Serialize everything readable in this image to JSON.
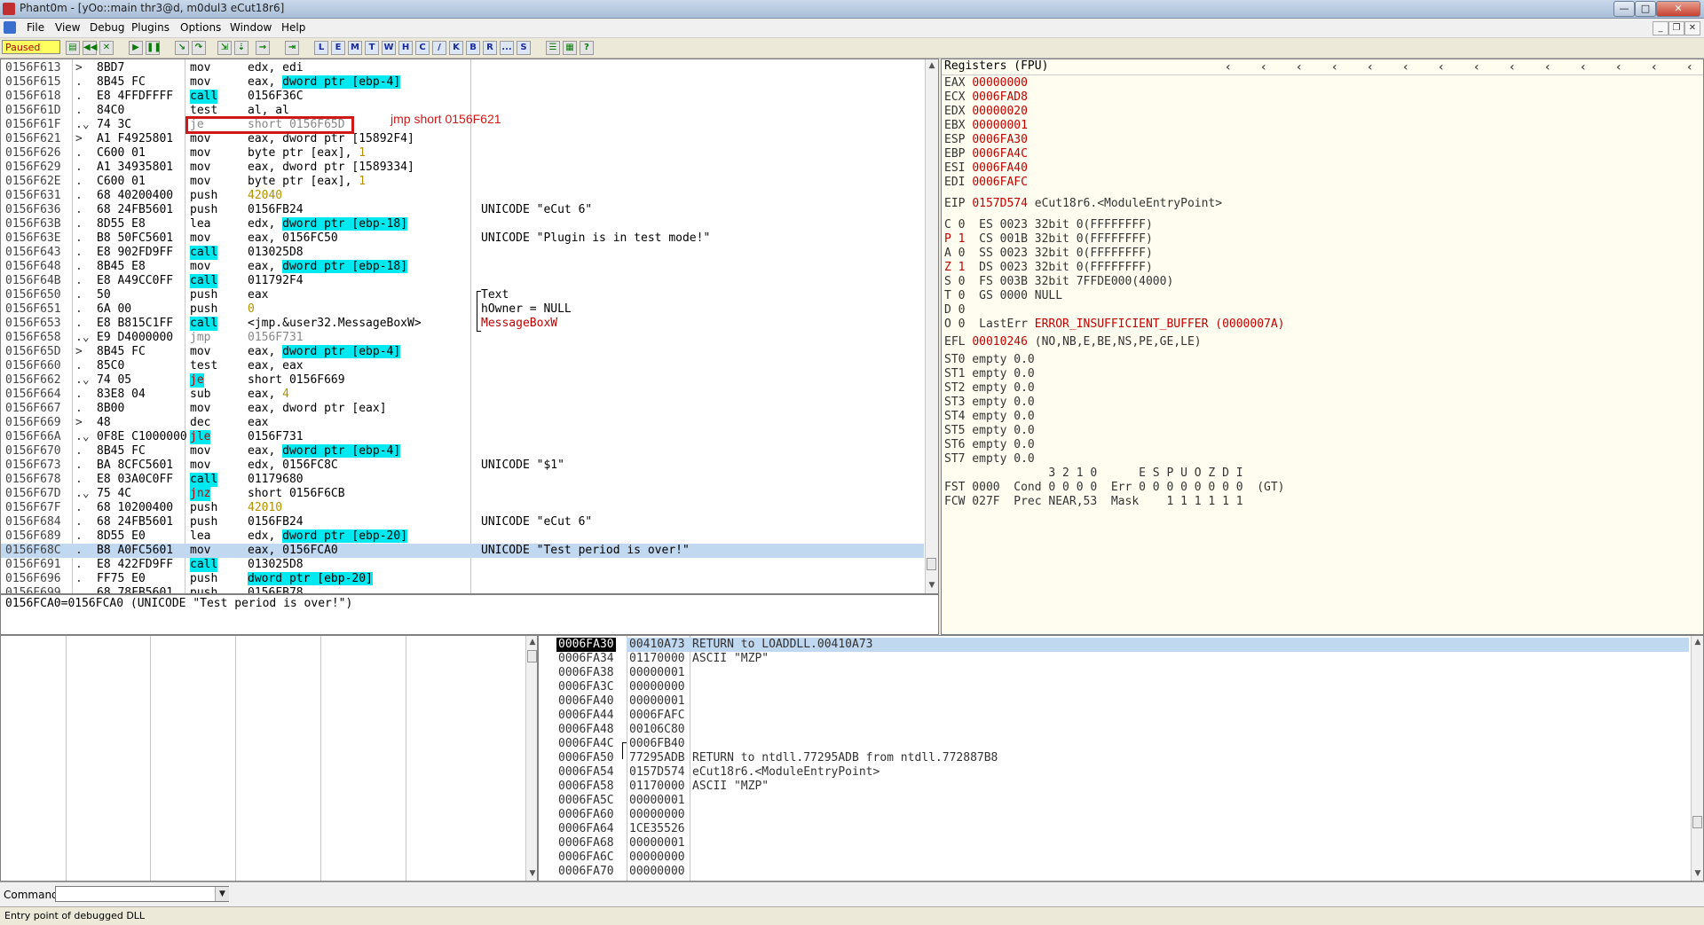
{
  "window": {
    "title": "Phant0m - [yOo::main thr3@d, m0dul3 eCut18r6]",
    "min_label": "—",
    "max_label": "□",
    "close_label": "✕"
  },
  "menu": [
    "File",
    "View",
    "Debug",
    "Plugins",
    "Options",
    "Window",
    "Help"
  ],
  "toolbar": {
    "status": "Paused",
    "letter_buttons": [
      "L",
      "E",
      "M",
      "T",
      "W",
      "H",
      "C",
      "/",
      "K",
      "B",
      "R",
      "...",
      "S"
    ]
  },
  "cpu": {
    "rows": [
      {
        "addr": "0156F613",
        "mark": ">",
        "hex": "8BD7",
        "mn": "mov",
        "op": "edx, edi",
        "cm": ""
      },
      {
        "addr": "0156F615",
        "mark": ".",
        "hex": "8B45 FC",
        "mn": "mov",
        "op": "eax, ",
        "mem": "dword ptr [ebp-4]",
        "cm": ""
      },
      {
        "addr": "0156F618",
        "mark": ".",
        "hex": "E8 4FFDFFFF",
        "mn": "call",
        "op": "0156F36C",
        "cm": "",
        "mnhl": true
      },
      {
        "addr": "0156F61D",
        "mark": ".",
        "hex": "84C0",
        "mn": "test",
        "op": "al, al",
        "cm": ""
      },
      {
        "addr": "0156F61F",
        "mark": ".⌄",
        "hex": "74 3C",
        "mn": "je",
        "op": "short 0156F65D",
        "cm": "",
        "grey": true
      },
      {
        "addr": "0156F621",
        "mark": ">",
        "hex": "A1 F4925801",
        "mn": "mov",
        "op": "eax, dword ptr [15892F4]",
        "cm": ""
      },
      {
        "addr": "0156F626",
        "mark": ".",
        "hex": "C600 01",
        "mn": "mov",
        "op": "byte ptr [eax], ",
        "num": "1",
        "cm": ""
      },
      {
        "addr": "0156F629",
        "mark": ".",
        "hex": "A1 34935801",
        "mn": "mov",
        "op": "eax, dword ptr [1589334]",
        "cm": ""
      },
      {
        "addr": "0156F62E",
        "mark": ".",
        "hex": "C600 01",
        "mn": "mov",
        "op": "byte ptr [eax], ",
        "num": "1",
        "cm": ""
      },
      {
        "addr": "0156F631",
        "mark": ".",
        "hex": "68 40200400",
        "mn": "push",
        "op": "",
        "num": "42040",
        "cm": ""
      },
      {
        "addr": "0156F636",
        "mark": ".",
        "hex": "68 24FB5601",
        "mn": "push",
        "op": "0156FB24",
        "cm": "UNICODE \"eCut 6\""
      },
      {
        "addr": "0156F63B",
        "mark": ".",
        "hex": "8D55 E8",
        "mn": "lea",
        "op": "edx, ",
        "mem": "dword ptr [ebp-18]",
        "cm": ""
      },
      {
        "addr": "0156F63E",
        "mark": ".",
        "hex": "B8 50FC5601",
        "mn": "mov",
        "op": "eax, 0156FC50",
        "cm": "UNICODE \"Plugin is in test mode!\""
      },
      {
        "addr": "0156F643",
        "mark": ".",
        "hex": "E8 902FD9FF",
        "mn": "call",
        "op": "013025D8",
        "cm": "",
        "mnhl": true
      },
      {
        "addr": "0156F648",
        "mark": ".",
        "hex": "8B45 E8",
        "mn": "mov",
        "op": "eax, ",
        "mem": "dword ptr [ebp-18]",
        "cm": ""
      },
      {
        "addr": "0156F64B",
        "mark": ".",
        "hex": "E8 A49CC0FF",
        "mn": "call",
        "op": "011792F4",
        "cm": "",
        "mnhl": true
      },
      {
        "addr": "0156F650",
        "mark": ".",
        "hex": "50",
        "mn": "push",
        "op": "eax",
        "cm": "Text"
      },
      {
        "addr": "0156F651",
        "mark": ".",
        "hex": "6A 00",
        "mn": "push",
        "op": "",
        "num": "0",
        "cm": "hOwner = NULL"
      },
      {
        "addr": "0156F653",
        "mark": ".",
        "hex": "E8 B815C1FF",
        "mn": "call",
        "op": "<jmp.&user32.MessageBoxW>",
        "cm": "MessageBoxW",
        "mnhl": true
      },
      {
        "addr": "0156F658",
        "mark": ".⌄",
        "hex": "E9 D4000000",
        "mn": "jmp",
        "op": "0156F731",
        "cm": "",
        "grey": true
      },
      {
        "addr": "0156F65D",
        "mark": ">",
        "hex": "8B45 FC",
        "mn": "mov",
        "op": "eax, ",
        "mem": "dword ptr [ebp-4]",
        "cm": ""
      },
      {
        "addr": "0156F660",
        "mark": ".",
        "hex": "85C0",
        "mn": "test",
        "op": "eax, eax",
        "cm": ""
      },
      {
        "addr": "0156F662",
        "mark": ".⌄",
        "hex": "74 05",
        "mn": "je",
        "op": "short 0156F669",
        "cm": "",
        "mnhl": true,
        "ylw": true
      },
      {
        "addr": "0156F664",
        "mark": ".",
        "hex": "83E8 04",
        "mn": "sub",
        "op": "eax, ",
        "num": "4",
        "cm": ""
      },
      {
        "addr": "0156F667",
        "mark": ".",
        "hex": "8B00",
        "mn": "mov",
        "op": "eax, dword ptr [eax]",
        "cm": ""
      },
      {
        "addr": "0156F669",
        "mark": ">",
        "hex": "48",
        "mn": "dec",
        "op": "eax",
        "cm": ""
      },
      {
        "addr": "0156F66A",
        "mark": ".⌄",
        "hex": "0F8E C1000000",
        "mn": "jle",
        "op": "0156F731",
        "cm": "",
        "mnhl": true,
        "ylw": true
      },
      {
        "addr": "0156F670",
        "mark": ".",
        "hex": "8B45 FC",
        "mn": "mov",
        "op": "eax, ",
        "mem": "dword ptr [ebp-4]",
        "cm": ""
      },
      {
        "addr": "0156F673",
        "mark": ".",
        "hex": "BA 8CFC5601",
        "mn": "mov",
        "op": "edx, 0156FC8C",
        "cm": "UNICODE \"$1\""
      },
      {
        "addr": "0156F678",
        "mark": ".",
        "hex": "E8 03A0C0FF",
        "mn": "call",
        "op": "01179680",
        "cm": "",
        "mnhl": true
      },
      {
        "addr": "0156F67D",
        "mark": ".⌄",
        "hex": "75 4C",
        "mn": "jnz",
        "op": "short 0156F6CB",
        "cm": "",
        "mnhl": true,
        "ylw": true
      },
      {
        "addr": "0156F67F",
        "mark": ".",
        "hex": "68 10200400",
        "mn": "push",
        "op": "",
        "num": "42010",
        "cm": ""
      },
      {
        "addr": "0156F684",
        "mark": ".",
        "hex": "68 24FB5601",
        "mn": "push",
        "op": "0156FB24",
        "cm": "UNICODE \"eCut 6\""
      },
      {
        "addr": "0156F689",
        "mark": ".",
        "hex": "8D55 E0",
        "mn": "lea",
        "op": "edx, ",
        "mem": "dword ptr [ebp-20]",
        "cm": ""
      },
      {
        "addr": "0156F68C",
        "mark": ".",
        "hex": "B8 A0FC5601",
        "mn": "mov",
        "op": "eax, 0156FCA0",
        "cm": "UNICODE \"Test period is over!\"",
        "selected": true
      },
      {
        "addr": "0156F691",
        "mark": ".",
        "hex": "E8 422FD9FF",
        "mn": "call",
        "op": "013025D8",
        "cm": "",
        "mnhl": true
      },
      {
        "addr": "0156F696",
        "mark": ".",
        "hex": "FF75 E0",
        "mn": "push",
        "op": "",
        "mem": "dword ptr [ebp-20]",
        "cm": ""
      },
      {
        "addr": "0156F699",
        "mark": ".",
        "hex": "68 78FB5601",
        "mn": "push",
        "op": "0156FB78",
        "cm": ""
      }
    ]
  },
  "annotation": {
    "text": "jmp short 0156F621"
  },
  "info_line": "0156FCA0=0156FCA0 (UNICODE \"Test period is over!\")",
  "registers": {
    "header": "Registers (FPU)",
    "gp": [
      {
        "name": "EAX",
        "val": "00000000",
        "sym": ""
      },
      {
        "name": "ECX",
        "val": "0006FAD8",
        "sym": ""
      },
      {
        "name": "EDX",
        "val": "00000020",
        "sym": ""
      },
      {
        "name": "EBX",
        "val": "00000001",
        "sym": ""
      },
      {
        "name": "ESP",
        "val": "0006FA30",
        "sym": ""
      },
      {
        "name": "EBP",
        "val": "0006FA4C",
        "sym": ""
      },
      {
        "name": "ESI",
        "val": "0006FA40",
        "sym": ""
      },
      {
        "name": "EDI",
        "val": "0006FAFC",
        "sym": ""
      }
    ],
    "eip": {
      "name": "EIP",
      "val": "0157D574",
      "sym": "eCut18r6.<ModuleEntryPoint>"
    },
    "flags": [
      {
        "flag": "C 0",
        "seg": "ES 0023 32bit 0(FFFFFFFF)"
      },
      {
        "flag": "P 1",
        "seg": "CS 001B 32bit 0(FFFFFFFF)"
      },
      {
        "flag": "A 0",
        "seg": "SS 0023 32bit 0(FFFFFFFF)"
      },
      {
        "flag": "Z 1",
        "seg": "DS 0023 32bit 0(FFFFFFFF)"
      },
      {
        "flag": "S 0",
        "seg": "FS 003B 32bit 7FFDE000(4000)"
      },
      {
        "flag": "T 0",
        "seg": "GS 0000 NULL"
      },
      {
        "flag": "D 0",
        "seg": ""
      }
    ],
    "lasterr": {
      "label": "O 0  LastErr",
      "val": "ERROR_INSUFFICIENT_BUFFER (0000007A)"
    },
    "efl": {
      "label": "EFL",
      "val": "00010246",
      "sym": "(NO,NB,E,BE,NS,PE,GE,LE)"
    },
    "st": [
      "ST0 empty 0.0",
      "ST1 empty 0.0",
      "ST2 empty 0.0",
      "ST3 empty 0.0",
      "ST4 empty 0.0",
      "ST5 empty 0.0",
      "ST6 empty 0.0",
      "ST7 empty 0.0"
    ],
    "fst_header": "               3 2 1 0      E S P U O Z D I",
    "fst": "FST 0000  Cond 0 0 0 0  Err 0 0 0 0 0 0 0 0  (GT)",
    "fcw": "FCW 027F  Prec NEAR,53  Mask    1 1 1 1 1 1"
  },
  "stack": [
    {
      "addr": "0006FA30",
      "val": "00410A73",
      "cm": "RETURN to LOADDLL.00410A73",
      "selected": true
    },
    {
      "addr": "0006FA34",
      "val": "01170000",
      "cm": "ASCII \"MZP\""
    },
    {
      "addr": "0006FA38",
      "val": "00000001",
      "cm": ""
    },
    {
      "addr": "0006FA3C",
      "val": "00000000",
      "cm": ""
    },
    {
      "addr": "0006FA40",
      "val": "00000001",
      "cm": ""
    },
    {
      "addr": "0006FA44",
      "val": "0006FAFC",
      "cm": ""
    },
    {
      "addr": "0006FA48",
      "val": "00106C80",
      "cm": ""
    },
    {
      "addr": "0006FA4C",
      "val": "0006FB40",
      "cm": ""
    },
    {
      "addr": "0006FA50",
      "val": "77295ADB",
      "cm": "RETURN to ntdll.77295ADB from ntdll.772887B8"
    },
    {
      "addr": "0006FA54",
      "val": "0157D574",
      "cm": "eCut18r6.<ModuleEntryPoint>"
    },
    {
      "addr": "0006FA58",
      "val": "01170000",
      "cm": "ASCII \"MZP\""
    },
    {
      "addr": "0006FA5C",
      "val": "00000001",
      "cm": ""
    },
    {
      "addr": "0006FA60",
      "val": "00000000",
      "cm": ""
    },
    {
      "addr": "0006FA64",
      "val": "1CE35526",
      "cm": ""
    },
    {
      "addr": "0006FA68",
      "val": "00000001",
      "cm": ""
    },
    {
      "addr": "0006FA6C",
      "val": "00000000",
      "cm": ""
    },
    {
      "addr": "0006FA70",
      "val": "00000000",
      "cm": ""
    }
  ],
  "command": {
    "label": "Command",
    "value": ""
  },
  "statusbar": "Entry point of debugged DLL"
}
